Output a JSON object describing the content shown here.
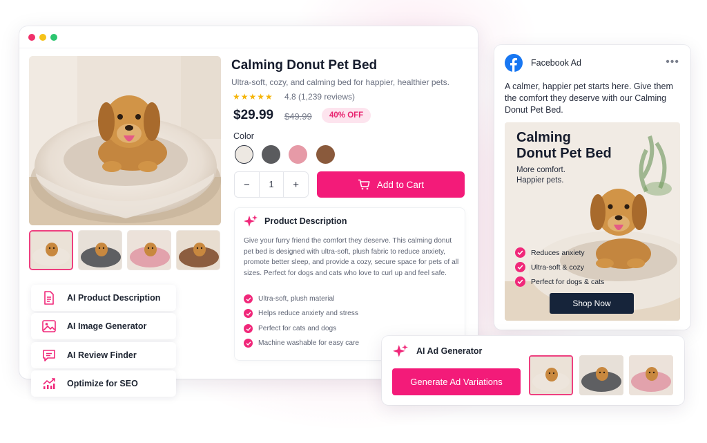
{
  "product": {
    "title": "Calming Donut Pet Bed",
    "subtitle": "Ultra-soft, cozy, and calming bed for happier, healthier pets.",
    "stars": "★★★★★",
    "rating": "4.8 (1,239 reviews)",
    "price": "$29.99",
    "old_price": "$49.99",
    "discount": "40% OFF",
    "color_label": "Color",
    "colors": [
      "#ede8e2",
      "#5a5b5e",
      "#e69aa7",
      "#8a5a3c"
    ],
    "qty_minus": "−",
    "qty_value": "1",
    "qty_plus": "+",
    "add_to_cart": "Add to Cart"
  },
  "description": {
    "title": "Product Description",
    "body": "Give your furry friend the comfort they deserve. This calming donut pet bed is designed with ultra-soft, plush fabric to reduce anxiety, promote better sleep, and provide a cozy, secure space for pets of all sizes. Perfect for dogs and cats who love to curl up and feel safe.",
    "bullets": [
      "Ultra-soft, plush material",
      "Helps reduce anxiety and stress",
      "Perfect for cats and dogs",
      "Machine washable for easy care"
    ]
  },
  "features": [
    {
      "label": "AI Product Description",
      "icon": "document-icon"
    },
    {
      "label": "AI Image Generator",
      "icon": "image-icon"
    },
    {
      "label": "AI Review Finder",
      "icon": "chat-icon"
    },
    {
      "label": "Optimize for SEO",
      "icon": "chart-icon"
    }
  ],
  "facebook": {
    "title": "Facebook Ad",
    "more": "•••",
    "text": "A calmer, happier pet starts here. Give them the comfort they deserve with our Calming Donut Pet Bed.",
    "headline_1": "Calming",
    "headline_2": "Donut Pet Bed",
    "tagline_1": "More comfort.",
    "tagline_2": "Happier pets.",
    "bullets": [
      "Reduces anxiety",
      "Ultra-soft & cozy",
      "Perfect for dogs & cats"
    ],
    "cta": "Shop Now"
  },
  "generator": {
    "title": "AI Ad Generator",
    "button": "Generate Ad Variations"
  },
  "colors": {
    "accent": "#f31b79",
    "navy": "#16243a",
    "facebook": "#1877f2"
  }
}
